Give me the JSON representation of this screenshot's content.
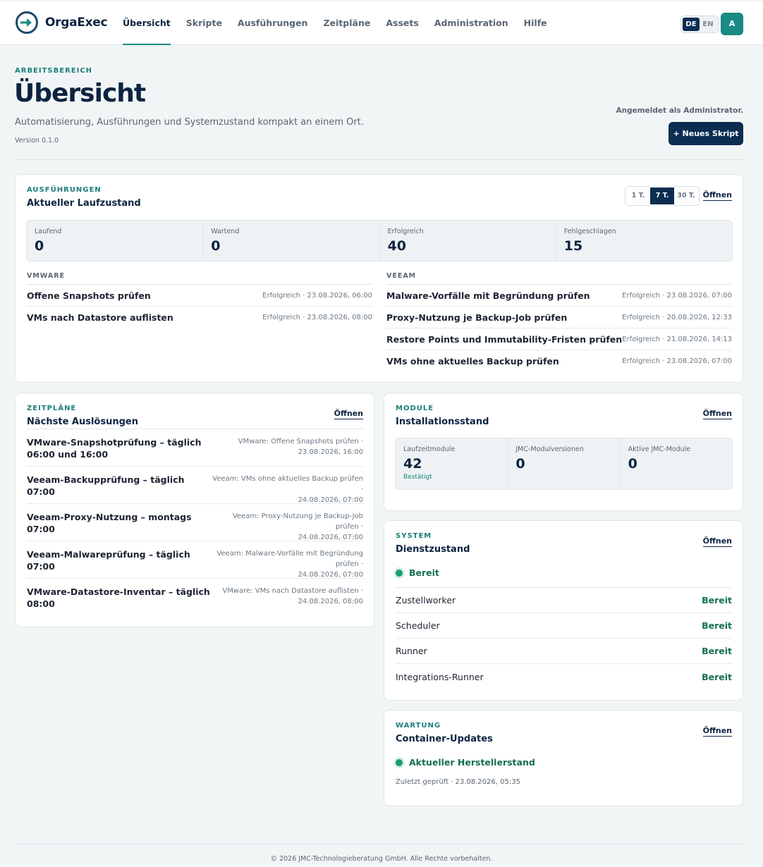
{
  "app": {
    "name": "OrgaExec"
  },
  "nav": {
    "items": [
      "Übersicht",
      "Skripte",
      "Ausführungen",
      "Zeitpläne",
      "Assets",
      "Administration",
      "Hilfe"
    ]
  },
  "lang": {
    "de": "DE",
    "en": "EN"
  },
  "user": {
    "avatar": "A",
    "logged_in": "Angemeldet als Administrator."
  },
  "header": {
    "eyebrow": "ARBEITSBEREICH",
    "title": "Übersicht",
    "subtitle": "Automatisierung, Ausführungen und Systemzustand kompakt an einem Ort.",
    "version": "Version 0.1.0",
    "new_script": "+ Neues Skript"
  },
  "runs": {
    "eyebrow": "AUSFÜHRUNGEN",
    "title": "Aktueller Laufzustand",
    "open": "Öffnen",
    "ranges": [
      "1 T.",
      "7 T.",
      "30 T."
    ],
    "stats": [
      {
        "label": "Laufend",
        "value": "0"
      },
      {
        "label": "Wartend",
        "value": "0"
      },
      {
        "label": "Erfolgreich",
        "value": "40"
      },
      {
        "label": "Fehlgeschlagen",
        "value": "15"
      }
    ],
    "groups": [
      {
        "name": "VMWARE",
        "items": [
          {
            "name": "Offene Snapshots prüfen",
            "meta": "Erfolgreich · 23.08.2026, 06:00"
          },
          {
            "name": "VMs nach Datastore auflisten",
            "meta": "Erfolgreich · 23.08.2026, 08:00"
          }
        ]
      },
      {
        "name": "VEEAM",
        "items": [
          {
            "name": "Malware-Vorfälle mit Begründung prüfen",
            "meta": "Erfolgreich · 23.08.2026, 07:00"
          },
          {
            "name": "Proxy-Nutzung je Backup-Job prüfen",
            "meta": "Erfolgreich · 20.08.2026, 12:33"
          },
          {
            "name": "Restore Points und Immutability-Fristen prüfen",
            "meta": "Erfolgreich · 21.08.2026, 14:13"
          },
          {
            "name": "VMs ohne aktuelles Backup prüfen",
            "meta": "Erfolgreich · 23.08.2026, 07:00"
          }
        ]
      }
    ]
  },
  "schedules": {
    "eyebrow": "ZEITPLÄNE",
    "title": "Nächste Auslösungen",
    "open": "Öffnen",
    "items": [
      {
        "name": "VMware-Snapshotprüfung – täglich 06:00 und 16:00",
        "script": "VMware: Offene Snapshots prüfen ·",
        "next": "23.08.2026, 16:00"
      },
      {
        "name": "Veeam-Backupprüfung – täglich 07:00",
        "script": "Veeam: VMs ohne aktuelles Backup prüfen ·",
        "next": "24.08.2026, 07:00"
      },
      {
        "name": "Veeam-Proxy-Nutzung – montags 07:00",
        "script": "Veeam: Proxy-Nutzung je Backup-Job prüfen ·",
        "next": "24.08.2026, 07:00"
      },
      {
        "name": "Veeam-Malwareprüfung – täglich 07:00",
        "script": "Veeam: Malware-Vorfälle mit Begründung prüfen ·",
        "next": "24.08.2026, 07:00"
      },
      {
        "name": "VMware-Datastore-Inventar – täglich 08:00",
        "script": "VMware: VMs nach Datastore auflisten ·",
        "next": "24.08.2026, 08:00"
      }
    ]
  },
  "modules": {
    "eyebrow": "MODULE",
    "title": "Installationsstand",
    "open": "Öffnen",
    "stats": [
      {
        "label": "Laufzeitmodule",
        "value": "42",
        "note": "Bestätigt"
      },
      {
        "label": "JMC-Modulversionen",
        "value": "0"
      },
      {
        "label": "Aktive JMC-Module",
        "value": "0"
      }
    ]
  },
  "system": {
    "eyebrow": "SYSTEM",
    "title": "Dienstzustand",
    "open": "Öffnen",
    "overall": "Bereit",
    "services": [
      {
        "name": "Zustellworker",
        "status": "Bereit"
      },
      {
        "name": "Scheduler",
        "status": "Bereit"
      },
      {
        "name": "Runner",
        "status": "Bereit"
      },
      {
        "name": "Integrations-Runner",
        "status": "Bereit"
      }
    ]
  },
  "maintenance": {
    "eyebrow": "WARTUNG",
    "title": "Container-Updates",
    "open": "Öffnen",
    "status": "Aktueller Herstellerstand",
    "checked": "Zuletzt geprüft · 23.08.2026, 05:35"
  },
  "footer": {
    "text": "© 2026 JMC-Technologieberatung GmbH. Alle Rechte vorbehalten."
  }
}
